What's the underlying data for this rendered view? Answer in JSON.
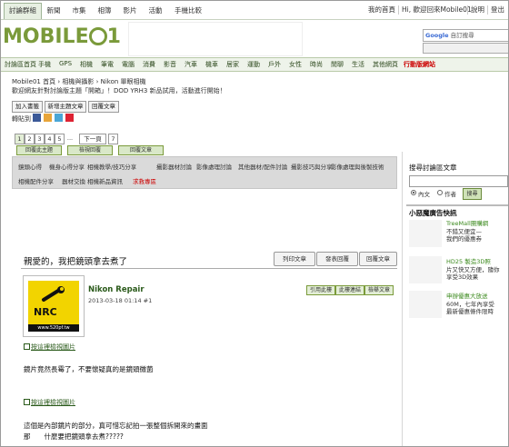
{
  "top_tabs": [
    {
      "label": "討論群組",
      "active": true
    },
    {
      "label": "新聞",
      "active": false
    },
    {
      "label": "市集",
      "active": false
    },
    {
      "label": "相簿",
      "active": false
    },
    {
      "label": "影片",
      "active": false
    },
    {
      "label": "活動",
      "active": false
    },
    {
      "label": "手機比較",
      "active": false
    }
  ],
  "top_links": {
    "my_home": "我的首頁",
    "welcome": "Hi, 歡迎回來Mobile01",
    "help": "說明",
    "logout": "登出"
  },
  "logo_text_a": "MOBILE",
  "logo_text_b": "1",
  "search": {
    "brand": "Google",
    "placeholder": "自訂搜尋"
  },
  "nav_items": [
    "討論區首頁",
    "手機",
    "GPS",
    "相機",
    "筆電",
    "電腦",
    "消費",
    "影音",
    "汽車",
    "機車",
    "居家",
    "運動",
    "戶外",
    "女性",
    "時尚",
    "閒聊",
    "生活",
    "其他網頁",
    "行動版網站"
  ],
  "breadcrumb": "Mobile01 首頁 › 相機與攝影 › Nikon 單眼相機",
  "notice": "歡迎網友針對討論版主題「開箱」！DOD YRH3 新品試用，活動進行開始！",
  "action_buttons": [
    "加入書籤",
    "新增主題文章",
    "回覆文章"
  ],
  "share_label": "轉貼到",
  "pager": {
    "pages": [
      "1",
      "2",
      "3",
      "4",
      "5",
      "...",
      "下一頁",
      "7"
    ]
  },
  "post_buttons": [
    "回覆此主題",
    "檢視回覆",
    "回覆文章"
  ],
  "categories": [
    [
      "鏡頭心得",
      "機身心得分享",
      "相機教學/技巧分享",
      "攝影器材討論",
      "影像處理討論",
      "其他器材/配件討論",
      "攝影技巧與分享",
      "影像處理與後製技術"
    ],
    [
      "相機配件分享",
      "器材交換",
      "相機新品資訊",
      "求救專區"
    ]
  ],
  "thread_title": "親愛的，我把鏡頭拿去煮了",
  "thread_buttons": [
    "列印文章",
    "發表回覆",
    "回覆文章"
  ],
  "post": {
    "username": "Nikon Repair",
    "date": "2013-03-18 01:14",
    "floor": "#1",
    "avatar_text": "NRC",
    "avatar_url": "www.520pf.tw",
    "buttons": [
      "引用此樓",
      "此樓連結",
      "檢舉文章"
    ],
    "image_link_1": "按這裡檢視圖片",
    "text_1": "鏡片竟然長霉了，不要懷疑真的是鏡頭黴菌",
    "image_link_2": "按這裡檢視圖片",
    "text_2a": "這個是內部鏡片的部分，真可惜忘記拍一張整個拆開來的畫面",
    "text_2b": "那　　什麼要把鏡頭拿去煮?????"
  },
  "sidebar": {
    "search_title": "搜尋討論區文章",
    "radio_a": "內文",
    "radio_b": "作者",
    "search_button": "搜尋",
    "ad_title": "小惡魔廣告快訊",
    "ads": [
      {
        "lines": [
          "TreeMall團購網",
          "不錯又便宜—",
          "我們的優惠券"
        ]
      },
      {
        "lines": [
          "HD25 製造3D照",
          "片又快又方便，隨你",
          "享受3D效果"
        ]
      },
      {
        "lines": [
          "申辦優惠大放送",
          "60M，七年內享受",
          "最新優惠條件限時"
        ]
      }
    ]
  },
  "colors": {
    "brand_green": "#7a9a3a",
    "nav_bg": "#eef3ea",
    "category_bg": "#dadada",
    "warn_red": "#cc0000"
  }
}
